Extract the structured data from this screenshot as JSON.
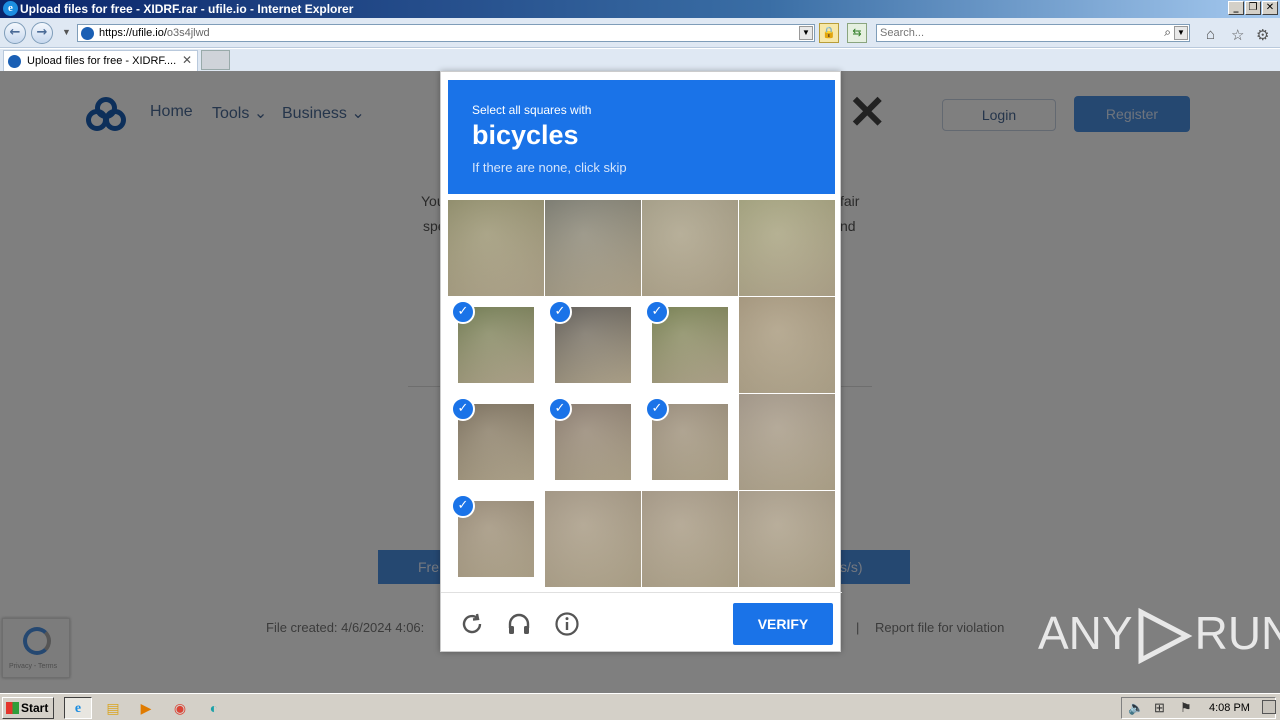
{
  "window": {
    "title": "Upload files for free - XIDRF.rar - ufile.io - Internet Explorer"
  },
  "addressbar": {
    "url_host": "https://ufile.io/",
    "url_path": "o3s4jlwd",
    "search_placeholder": "Search..."
  },
  "tab": {
    "label": "Upload files for free - XIDRF...."
  },
  "page": {
    "nav": [
      "Home",
      "Tools",
      "Business"
    ],
    "login": "Login",
    "register": "Register",
    "card_text_left_1": "You",
    "card_text_left_2": "spe",
    "card_text_right_1": "fair",
    "card_text_right_2": "nd",
    "free_button_left": "Fre",
    "free_button_right": "s/s)",
    "file_created": "File created: 4/6/2024 4:06:",
    "separator": "|",
    "report": "Report file for violation",
    "recaptcha_badge": "Privacy - Terms"
  },
  "captcha": {
    "prefix": "Select all squares with",
    "target": "bicycles",
    "hint": "If there are none, click skip",
    "verify": "VERIFY",
    "icons": [
      "reload-icon",
      "audio-icon",
      "info-icon"
    ],
    "tiles_selected": [
      false,
      false,
      false,
      false,
      true,
      true,
      true,
      false,
      true,
      true,
      true,
      false,
      true,
      false,
      false,
      false
    ]
  },
  "watermark": {
    "left": "ANY",
    "right": "RUN"
  },
  "taskbar": {
    "start": "Start",
    "clock": "4:08 PM"
  },
  "colors": {
    "accent": "#1a73e8",
    "ie_titlebar": "#0a246a",
    "taskbar": "#d4d0c8"
  }
}
